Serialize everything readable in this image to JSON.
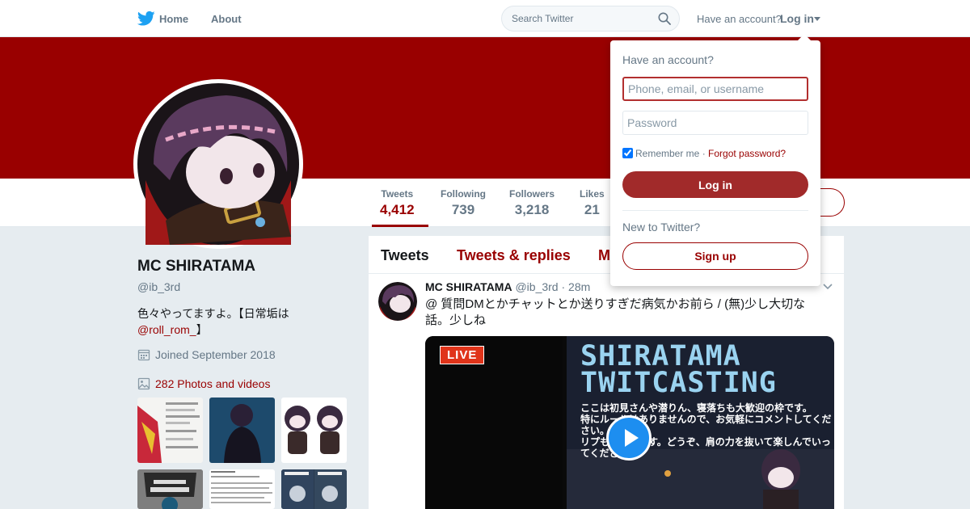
{
  "nav": {
    "home": "Home",
    "about": "About",
    "search_placeholder": "Search Twitter",
    "have_account": "Have an account?",
    "login": "Log in"
  },
  "profile": {
    "name": "MC SHIRATAMA",
    "handle": "@ib_3rd",
    "bio_text": "色々やってますよ。【日常垢は",
    "bio_link": "@roll_rom_",
    "bio_end": "】",
    "joined": "Joined September 2018",
    "photos": "282 Photos and videos"
  },
  "stats": [
    {
      "label": "Tweets",
      "value": "4,412"
    },
    {
      "label": "Following",
      "value": "739"
    },
    {
      "label": "Followers",
      "value": "3,218"
    },
    {
      "label": "Likes",
      "value": "21"
    }
  ],
  "timeline": {
    "tabs": [
      "Tweets",
      "Tweets & replies",
      "M"
    ],
    "tweet": {
      "name": "MC SHIRATAMA",
      "handle": "@ib_3rd",
      "time": "· 28m",
      "text": "@ 質問DMとかチャットとか送りすぎだ病気かお前ら / (無)少し大切な話。少しね",
      "media": {
        "live": "LIVE",
        "title1": "SHIRATAMA",
        "title2": "TWITCASTING",
        "line1": "ここは初見さんや潜りん、寝落ちも大歓迎の枠です。",
        "line2": "特にルールはありませんので、お気軽にコメントしてください。",
        "line3": "リプも大歓迎です。どうぞ、肩の力を抜いて楽しんでいってください。"
      }
    }
  },
  "login_dropdown": {
    "title": "Have an account?",
    "username_placeholder": "Phone, email, or username",
    "password_placeholder": "Password",
    "remember": "Remember me",
    "separator": " · ",
    "forgot": "Forgot password?",
    "login_button": "Log in",
    "new_to": "New to Twitter?",
    "signup_button": "Sign up"
  },
  "colors": {
    "brand": "#990000",
    "twitter_blue": "#1da1f2"
  }
}
